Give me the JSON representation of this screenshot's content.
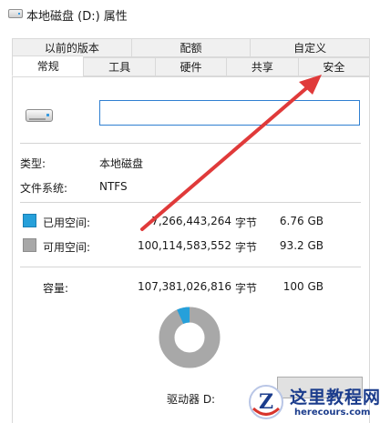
{
  "window": {
    "title": "本地磁盘 (D:) 属性"
  },
  "tabs": {
    "back_row": [
      {
        "label": "以前的版本"
      },
      {
        "label": "配额"
      },
      {
        "label": "自定义"
      }
    ],
    "front_row": [
      {
        "label": "常规",
        "active": true
      },
      {
        "label": "工具"
      },
      {
        "label": "硬件"
      },
      {
        "label": "共享"
      },
      {
        "label": "安全"
      }
    ]
  },
  "general": {
    "drive_name_value": "",
    "type_label": "类型:",
    "type_value": "本地磁盘",
    "fs_label": "文件系统:",
    "fs_value": "NTFS",
    "used": {
      "label": "已用空间:",
      "bytes": "7,266,443,264",
      "unit": "字节",
      "size": "6.76 GB",
      "color": "#26a0da"
    },
    "free": {
      "label": "可用空间:",
      "bytes": "100,114,583,552",
      "unit": "字节",
      "size": "93.2 GB",
      "color": "#a8a8a8"
    },
    "capacity": {
      "label": "容量:",
      "bytes": "107,381,026,816",
      "unit": "字节",
      "size": "100 GB"
    },
    "usage_fraction": 0.0677,
    "drive_label": "驱动器 D:"
  },
  "annotation": {
    "color": "#e03a3a"
  },
  "watermark": {
    "title": "这里教程网",
    "url": "herecours.com",
    "letter": "Z"
  }
}
